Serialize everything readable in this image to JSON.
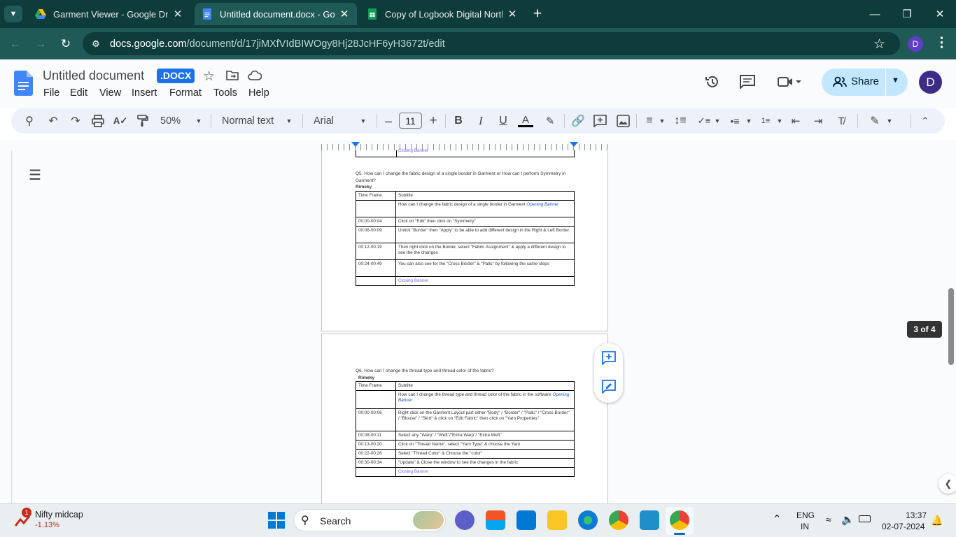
{
  "browser": {
    "tabs": [
      {
        "title": "Garment Viewer - Google Drive",
        "icon": "google-drive-icon",
        "active": false
      },
      {
        "title": "Untitled document.docx - Goog",
        "icon": "google-docs-icon",
        "active": true
      },
      {
        "title": "Copy of Logbook Digital North",
        "icon": "google-sheets-icon",
        "active": false
      }
    ],
    "url_domain": "docs.google.com",
    "url_path": "/document/d/17jiMXfVIdBIWOgy8Hj28JcHF6yH3672t/edit",
    "profile_initial": "D"
  },
  "docs": {
    "title": "Untitled document",
    "badge": ".DOCX",
    "menu": [
      "File",
      "Edit",
      "View",
      "Insert",
      "Format",
      "Tools",
      "Help"
    ],
    "share_label": "Share",
    "avatar_initial": "D",
    "toolbar": {
      "zoom": "50%",
      "style": "Normal text",
      "font": "Arial",
      "font_size": "11"
    },
    "page_indicator": "3 of 4"
  },
  "document": {
    "top_fragment": "Closing Banner",
    "q5": {
      "question": "Q5. How can I change the fabric design of a single border in Garment or How can I perform Symmetry in Garment?",
      "author": "Rimeky",
      "header": [
        "Time Frame",
        "Subtitle"
      ],
      "rows": [
        {
          "time": "",
          "text": "How can I change the fabric design of a single border in Garment ",
          "extra": "Opening Banner"
        },
        {
          "time": "00:00-00:04",
          "text": "Click on \"Edit\" then click on \"Symmetry\""
        },
        {
          "time": "00:06-00:09",
          "text": "Untick \"Border\" then \"Apply\" to be able to add different design in the  Right & Left Border"
        },
        {
          "time": "00:12-00:19",
          "text": "Then right click on the Border, select \"Fabric Assignment\" & apply a different design to see the the changes"
        },
        {
          "time": "00:24-00:49",
          "text": "You can also see for the \"Cross Border\" & \"Pallu\" by following the same steps"
        },
        {
          "time": "",
          "text": "Closing Banner"
        }
      ]
    },
    "q6": {
      "question": "Q6. How can I change the thread type and thread color of the fabric?",
      "author": "Rimeky",
      "header": [
        "Time Frame",
        "Subtitle"
      ],
      "rows": [
        {
          "time": "",
          "text": "How can I change the thread type and thread color of the fabric in the software ",
          "extra": "Opening Banner"
        },
        {
          "time": "00:00-00:06",
          "text": "Right click on the Garment Layout part either \"Body\" / \"Border\" / \"Pallu\" / \"Cross Border\" / \"Blouse\" / \"Skirt\" & click on \"Edit Fabric\" then click on \"Yarn Properties\""
        },
        {
          "time": "00:08-00:11",
          "text": "Select any  \"Warp\" / \"Weft\"/\"Extra Warp\"/ \"Extra Weft\""
        },
        {
          "time": "00:13-00:20",
          "text": "Click on \"Thread Name\", select \"Yarn Type\" & choose the Yarn"
        },
        {
          "time": "00:22-00:26",
          "text": "Select \"Thread Color\" & Choose the \"color\""
        },
        {
          "time": "00:30-00:34",
          "text": "\"Update\" & Close the window to see the changes in the fabric"
        },
        {
          "time": "",
          "text": "Closing Banner"
        }
      ]
    }
  },
  "taskbar": {
    "widget_title": "Nifty midcap",
    "widget_value": "-1.13%",
    "widget_badge": "1",
    "search_placeholder": "Search",
    "lang_line1": "ENG",
    "lang_line2": "IN",
    "time": "13:37",
    "date": "02-07-2024"
  },
  "colors": {
    "tab_strip": "#0e3c3a",
    "address_bar": "#1f5a57",
    "share_button": "#c2e7ff",
    "docx_badge": "#1a73e8",
    "link_blue": "#1155cc"
  }
}
